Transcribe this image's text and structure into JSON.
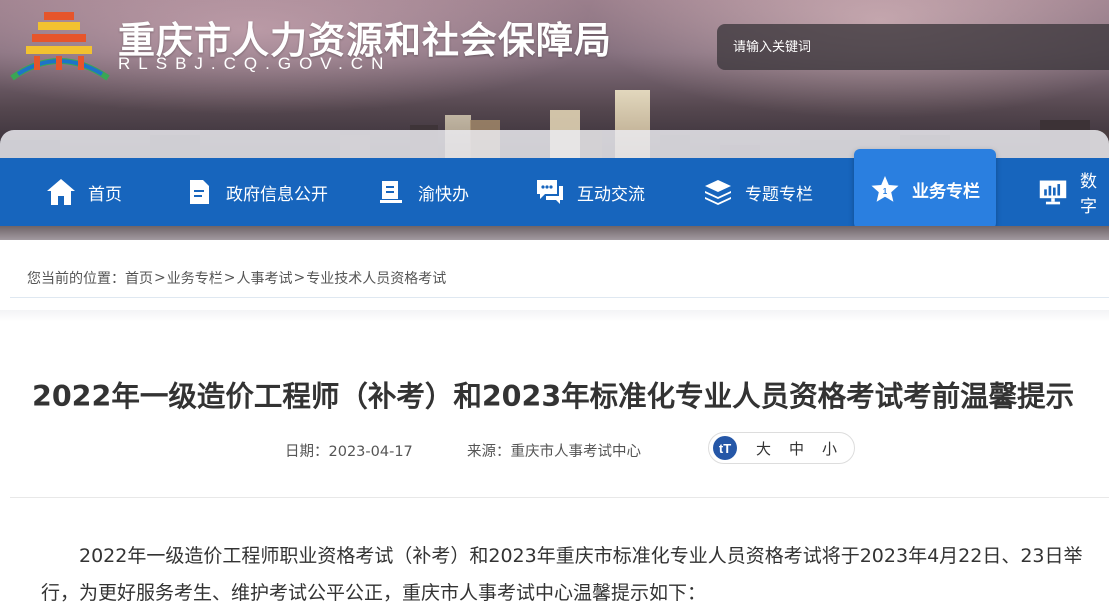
{
  "header": {
    "site_title": "重庆市人力资源和社会保障局",
    "site_domain": "RLSBJ.CQ.GOV.CN",
    "search_placeholder": "请输入关键词"
  },
  "nav": {
    "items": [
      {
        "label": "首页",
        "icon": "home-icon"
      },
      {
        "label": "政府信息公开",
        "icon": "document-icon"
      },
      {
        "label": "渝快办",
        "icon": "book-icon"
      },
      {
        "label": "互动交流",
        "icon": "chat-icon"
      },
      {
        "label": "专题专栏",
        "icon": "layers-icon"
      },
      {
        "label": "业务专栏",
        "icon": "star-icon",
        "active": true
      },
      {
        "label": "数字",
        "icon": "monitor-chart-icon"
      }
    ]
  },
  "breadcrumb": {
    "prefix": "您当前的位置：",
    "items": [
      "首页",
      "业务专栏",
      "人事考试",
      "专业技术人员资格考试"
    ]
  },
  "article": {
    "title": "2022年一级造价工程师（补考）和2023年标准化专业人员资格考试考前温馨提示",
    "date_label": "日期：",
    "date": "2023-04-17",
    "source_label": "来源：",
    "source": "重庆市人事考试中心",
    "font_icon_text": "tT",
    "font_sizes": [
      "大",
      "中",
      "小"
    ],
    "body": "2022年一级造价工程师职业资格考试（补考）和2023年重庆市标准化专业人员资格考试将于2023年4月22日、23日举行，为更好服务考生、维护考试公平公正，重庆市人事考试中心温馨提示如下："
  },
  "colors": {
    "nav_bg": "#1765bd",
    "nav_active": "#2a7fe0",
    "font_icon_bg": "#2557a7"
  }
}
